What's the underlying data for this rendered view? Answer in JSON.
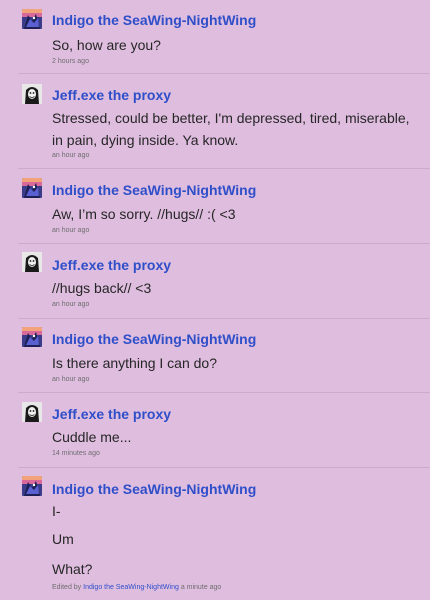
{
  "icons": {
    "indigo_avatar": "indigo-nightwing-avatar-icon",
    "jeff_avatar": "jeff-proxy-avatar-icon"
  },
  "colors": {
    "background": "#dfbddf",
    "author_link": "#2f4fc9",
    "divider": "#cfa9cf",
    "body_text": "#262626",
    "meta_text": "#6e6e6e"
  },
  "comments": [
    {
      "author": "Indigo the SeaWing-NightWing",
      "text": "So, how are you?",
      "time": "2 hours ago"
    },
    {
      "author": "Jeff.exe the proxy",
      "text": "Stressed, could be better, I'm depressed, tired, miserable, in pain, dying inside. Ya know.",
      "time": "an hour ago"
    },
    {
      "author": "Indigo the SeaWing-NightWing",
      "text": "Aw, I’m so sorry. //hugs// :( <3",
      "time": "an hour ago"
    },
    {
      "author": "Jeff.exe the proxy",
      "text": "//hugs back// <3",
      "time": "an hour ago"
    },
    {
      "author": "Indigo the SeaWing-NightWing",
      "text": "Is there anything I can do?",
      "time": "an hour ago"
    },
    {
      "author": "Jeff.exe the proxy",
      "text": "Cuddle me...",
      "time": "14 minutes ago"
    },
    {
      "author": "Indigo the SeaWing-NightWing",
      "lines": [
        "I-",
        "Um",
        "What?"
      ],
      "edited_prefix": "Edited by",
      "edited_by": "Indigo the SeaWing-NightWing",
      "time": "a minute ago"
    }
  ]
}
